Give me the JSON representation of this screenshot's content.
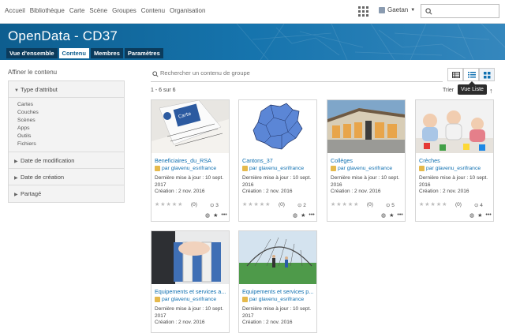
{
  "topnav": {
    "links": [
      "Accueil",
      "Bibliothèque",
      "Carte",
      "Scène",
      "Groupes",
      "Contenu",
      "Organisation"
    ],
    "user": "Gaetan"
  },
  "banner": {
    "title": "OpenData - CD37"
  },
  "tabs": [
    {
      "label": "Vue d'ensemble",
      "active": false
    },
    {
      "label": "Contenu",
      "active": true
    },
    {
      "label": "Membres",
      "active": false
    },
    {
      "label": "Paramètres",
      "active": false
    }
  ],
  "sidebar": {
    "heading": "Affiner le contenu",
    "type_label": "Type d'attribut",
    "types": [
      "Cartes",
      "Couches",
      "Scènes",
      "Apps",
      "Outils",
      "Fichiers"
    ],
    "filters": [
      "Date de modification",
      "Date de création",
      "Partagé"
    ]
  },
  "search": {
    "placeholder": "Rechercher un contenu de groupe"
  },
  "results": {
    "count": "1 - 6 sur 6",
    "sort_label": "Trier",
    "tooltip": "Vue Liste"
  },
  "cards": [
    {
      "title": "Beneficiaires_du_RSA",
      "owner": "par glavenu_esrifrance",
      "modified": "Dernière mise à jour : 10 sept. 2017",
      "created": "Création : 2 nov. 2016",
      "rating": "(0)",
      "views": "3"
    },
    {
      "title": "Cantons_37",
      "owner": "par glavenu_esrifrance",
      "modified": "Dernière mise à jour : 10 sept. 2016",
      "created": "Création : 2 nov. 2016",
      "rating": "(0)",
      "views": "2"
    },
    {
      "title": "Collèges",
      "owner": "par glavenu_esrifrance",
      "modified": "Dernière mise à jour : 10 sept. 2016",
      "created": "Création : 2 nov. 2016",
      "rating": "(0)",
      "views": "5"
    },
    {
      "title": "Crèches",
      "owner": "par glavenu_esrifrance",
      "modified": "Dernière mise à jour : 10 sept. 2016",
      "created": "Création : 2 nov. 2016",
      "rating": "(0)",
      "views": "4"
    },
    {
      "title": "Equipements et services a...",
      "owner": "par glavenu_esrifrance",
      "modified": "Dernière mise à jour : 10 sept. 2017",
      "created": "Création : 2 nov. 2016",
      "rating": "",
      "views": ""
    },
    {
      "title": "Equipements et services p...",
      "owner": "par glavenu_esrifrance",
      "modified": "Dernière mise à jour : 10 sept. 2017",
      "created": "Création : 2 nov. 2016",
      "rating": "",
      "views": ""
    }
  ],
  "colors": {
    "banner": "#1674ad",
    "link": "#0e6fb0",
    "tab_dark": "#0b3b5c"
  }
}
